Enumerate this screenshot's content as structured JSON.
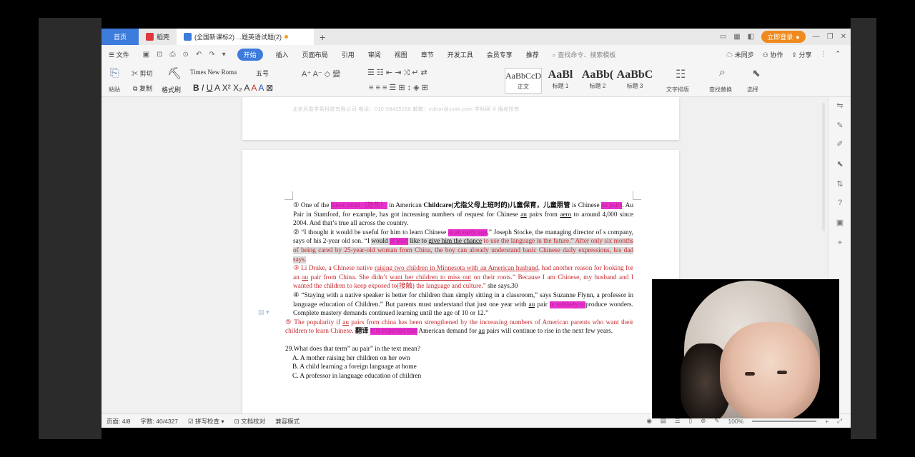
{
  "tabs": {
    "home": "首页",
    "app": "稻壳",
    "doc": "(全国新课标2) ...题英语试题(2)",
    "add": "+"
  },
  "titlebar": {
    "login": "立即登录"
  },
  "menu": {
    "file": "文件",
    "start": "开始",
    "items": [
      "插入",
      "页面布局",
      "引用",
      "审阅",
      "视图",
      "章节",
      "开发工具",
      "会员专享",
      "推荐"
    ],
    "search": "查找命令、搜索模板",
    "right": [
      "未同步",
      "协作",
      "分享"
    ]
  },
  "ribbon": {
    "paste": "粘贴",
    "cut": "剪切",
    "copy": "复制",
    "format_painter": "格式刷",
    "font": "Times New Roma",
    "size": "五号",
    "styles": [
      {
        "sample": "AaBbCcDd",
        "label": "正文"
      },
      {
        "sample": "AaBl",
        "label": "标题 1"
      },
      {
        "sample": "AaBb(",
        "label": "标题 2"
      },
      {
        "sample": "AaBbC",
        "label": "标题 3"
      }
    ],
    "text_layout": "文字排版",
    "find_replace": "查找替换",
    "select": "选择"
  },
  "doc": {
    "header": "北京凤凰学易科技有限公司     电话：010-58425260     邮箱：editor@zxxk.com     学科网 © 版权所有",
    "p1_a": "① One of the ",
    "p1_hl1": "latest trend（趋势）",
    "p1_b": " in American ",
    "p1_bold": "Childcare(尤指父母上班时的)儿童保育，儿童照管",
    "p1_c": " is Chinese ",
    "p1_hl2": "au pairs",
    "p1_d": ". Au Pair in Stamford, for example, has got increasing numbers of request for Chinese ",
    "p1_u1": "au",
    "p1_e": " pairs from ",
    "p1_u2": "aero",
    "p1_f": " to around 4,000 since 2004. And that’s true all across the country.",
    "p2_a": "② “I thought it would be useful for him to learn Chinese ",
    "p2_hl": "at an early age",
    "p2_b": ",” Joseph Stocke, the managing director of s company, says of his 2-year old son. “I ",
    "p2_gray1": "would ",
    "p2_hl2": "at least",
    "p2_c": " like to    ",
    "p2_gray2": "give him the chance",
    "p2_red": " to use the language in the future.” After only six months of being cared by 25-year-old woman from China, the boy can already understand basic Chinese daily expressions, his dad    says.",
    "p3_a": "③ Li Drake, a Chinese native ",
    "p3_u1": "raising two children in Minnesota with an American husband",
    "p3_b": ", had another reason for looking for an ",
    "p3_u2": "au",
    "p3_c": " pair from China. She didn’t ",
    "p3_u3": "want her children to miss out",
    "p3_d": " on their roots.” Because I am Chinese, my husband and I wanted the children to keep exposed to(接触) the language and culture.”",
    "p3_e": " she says.30",
    "p4_a": "④  “Staying with a native speaker is better for children than simply sitting in a classroom,” says Suzanne Flynn, a professor in language education of Children.” But parents must understand that just one year with ",
    "p4_u": "au",
    "p4_b": " pair ",
    "p4_hl": "is unlikely to",
    "p4_c": "produce wonders.    Complete mastery demands continued learning until the age of 10 or 12.”",
    "p5_a": "⑤  The popularity if ",
    "p5_u": "au",
    "p5_b": " pairs from china has been strengthened by the increasing numbers of American parents who want their children to learn Chinese.",
    "p5_bold": " 翻译 ",
    "p5_hl": "It is expected that",
    "p5_c": " American demand for ",
    "p5_u2": "au",
    "p5_d": " pairs will continue to rise in the next few years.",
    "q29": "29.What does that term” au pair” in the text mean?",
    "optA": "A. A mother raising her children on her own",
    "optB": "B. A child learning a foreign language at home",
    "optC": "C. A professor in language education of children"
  },
  "status": {
    "page": "页面: 4/8",
    "words": "字数: 40/4327",
    "spell": "拼写检查",
    "proof": "文档校对",
    "mode": "兼容模式",
    "zoom": "100%"
  },
  "colors": {
    "accent": "#3d7bdc",
    "highlight": "#e633cc",
    "red_text": "#c8282e",
    "login": "#f08a1c"
  }
}
